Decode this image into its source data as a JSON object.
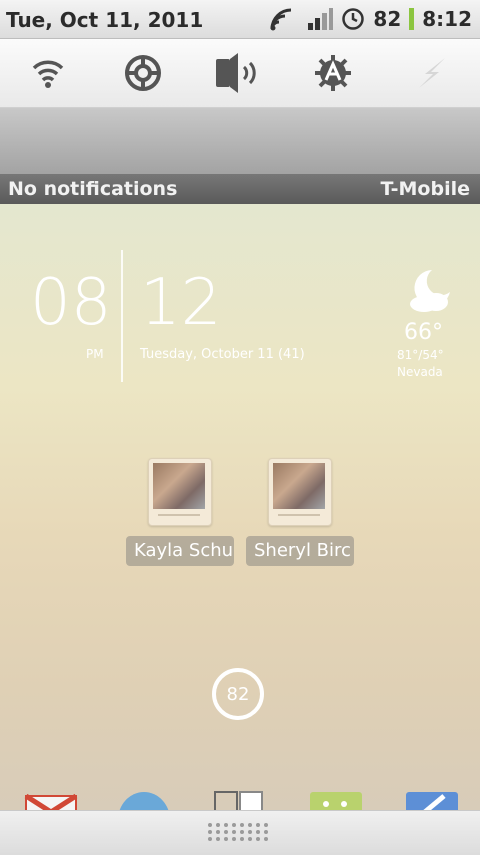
{
  "status_bar": {
    "date": "Tue, Oct 11, 2011",
    "battery_level": "82",
    "time": "8:12",
    "icons": [
      "wifi-icon",
      "signal-icon",
      "alarm-icon",
      "battery-icon"
    ]
  },
  "toggles": [
    "wifi-toggle-icon",
    "gps-toggle-icon",
    "sound-toggle-icon",
    "brightness-auto-icon",
    "flash-icon"
  ],
  "notifications": {
    "status": "No notifications",
    "carrier": "T-Mobile"
  },
  "clock": {
    "hour": "08",
    "ampm": "PM",
    "minute": "12",
    "date": "Tuesday, October 11 (41)"
  },
  "weather": {
    "icon": "moon-cloud-icon",
    "temp": "66°",
    "range": "81°/54°",
    "location": "Nevada"
  },
  "contacts": [
    {
      "label": "Kayla Schu"
    },
    {
      "label": "Sheryl Birc"
    }
  ],
  "battery_widget": {
    "value": "82"
  },
  "colors": {
    "battery_accent": "#8bc53f",
    "notification_bar": "#5a5a5a"
  }
}
